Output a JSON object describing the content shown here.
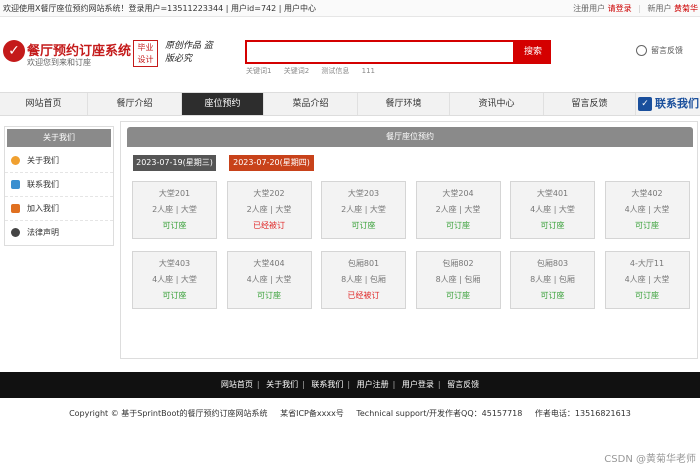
{
  "topbar": {
    "welcome": "欢迎使用X餐厅座位预约网站系统！登录用户=13511223344 | 用户id=742 | 用户中心",
    "register": "注册用户",
    "login": "请登录",
    "news": "新用户",
    "user": "黄菊华"
  },
  "header": {
    "logo_mark": "✓",
    "title": "餐厅预约订座系统",
    "subtitle": "欢迎您到来和订座",
    "badge": [
      "毕业",
      "设计"
    ],
    "slogan": "原创作品 盗版必究",
    "search_button": "搜索",
    "search_placeholder": "",
    "hot_words": [
      "关键词1",
      "关键词2",
      "测试信息",
      "111"
    ],
    "feedback": "留言反馈"
  },
  "nav": {
    "items": [
      "网站首页",
      "餐厅介绍",
      "座位预约",
      "菜品介绍",
      "餐厅环境",
      "资讯中心",
      "留言反馈"
    ],
    "active_index": 2,
    "contact": "联系我们"
  },
  "sidebar": {
    "title": "关于我们",
    "links": [
      {
        "label": "关于我们",
        "color": "#f0a030"
      },
      {
        "label": "联系我们",
        "color": "#3a8fd0"
      },
      {
        "label": "加入我们",
        "color": "#e07020"
      },
      {
        "label": "法律声明",
        "color": "#444444"
      }
    ]
  },
  "booking": {
    "title": "餐厅座位预约",
    "dates": [
      "2023-07-19(星期三)",
      "2023-07-20(星期四)"
    ],
    "selected_date": 1,
    "seats": [
      {
        "name": "大堂201",
        "info": "2人座 | 大堂",
        "status": "可订座",
        "booked": false
      },
      {
        "name": "大堂202",
        "info": "2人座 | 大堂",
        "status": "已经被订",
        "booked": true
      },
      {
        "name": "大堂203",
        "info": "2人座 | 大堂",
        "status": "可订座",
        "booked": false
      },
      {
        "name": "大堂204",
        "info": "2人座 | 大堂",
        "status": "可订座",
        "booked": false
      },
      {
        "name": "大堂401",
        "info": "4人座 | 大堂",
        "status": "可订座",
        "booked": false
      },
      {
        "name": "大堂402",
        "info": "4人座 | 大堂",
        "status": "可订座",
        "booked": false
      },
      {
        "name": "大堂403",
        "info": "4人座 | 大堂",
        "status": "可订座",
        "booked": false
      },
      {
        "name": "大堂404",
        "info": "4人座 | 大堂",
        "status": "可订座",
        "booked": false
      },
      {
        "name": "包厢801",
        "info": "8人座 | 包厢",
        "status": "已经被订",
        "booked": true
      },
      {
        "name": "包厢802",
        "info": "8人座 | 包厢",
        "status": "可订座",
        "booked": false
      },
      {
        "name": "包厢803",
        "info": "8人座 | 包厢",
        "status": "可订座",
        "booked": false
      },
      {
        "name": "4-大厅11",
        "info": "4人座 | 大堂",
        "status": "可订座",
        "booked": false
      }
    ]
  },
  "footer": {
    "links": [
      "网站首页",
      "关于我们",
      "联系我们",
      "用户注册",
      "用户登录",
      "留言反馈"
    ],
    "copyright": "Copyright © 基于SprintBoot的餐厅预约订座网站系统",
    "icp": "某省ICP备xxxx号",
    "support": "Technical support/开发作者QQ：45157718",
    "phone": "作者电话：13516821613"
  },
  "watermark": "CSDN @黄菊华老师"
}
